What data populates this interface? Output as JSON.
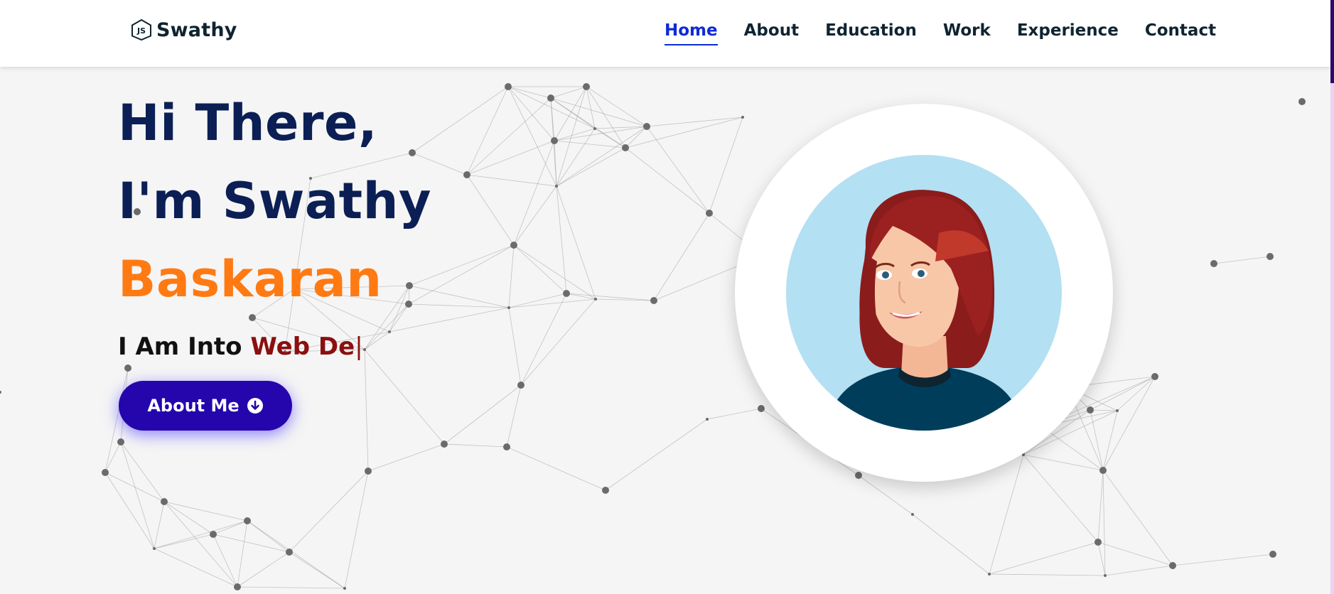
{
  "nav": {
    "brand": "Swathy",
    "brand_icon": "nodejs-icon",
    "links": [
      {
        "label": "Home",
        "active": true
      },
      {
        "label": "About",
        "active": false
      },
      {
        "label": "Education",
        "active": false
      },
      {
        "label": "Work",
        "active": false
      },
      {
        "label": "Experience",
        "active": false
      },
      {
        "label": "Contact",
        "active": false
      }
    ]
  },
  "hero": {
    "line1": "Hi There,",
    "line2": "I'm Swathy",
    "line3": "Baskaran",
    "typing_prefix": "I Am Into ",
    "typing_value": "Web De",
    "typing_cursor": "|",
    "button_label": "About Me",
    "button_icon": "arrow-down-circle-icon",
    "avatar_icon": "avatar-illustration"
  },
  "colors": {
    "nav_active": "#0e2bd6",
    "heading": "#0b1f55",
    "accent_orange": "#ff7a12",
    "typed_text": "#8b0f0f",
    "button_bg": "#2506ad",
    "avatar_bg": "#b3e0f2"
  }
}
